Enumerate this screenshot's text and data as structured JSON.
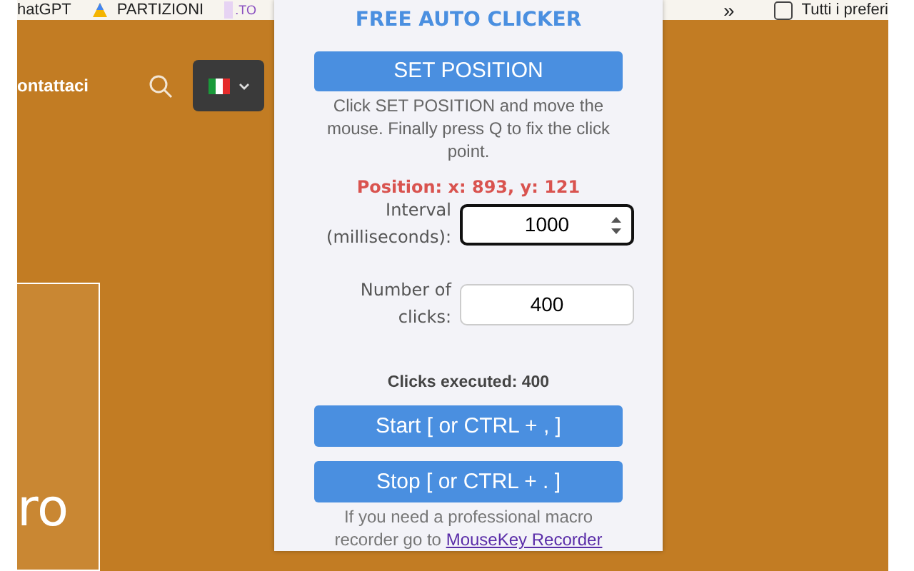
{
  "bookmarks_bar": {
    "items": [
      {
        "kind": "plain",
        "label": "hatGPT"
      },
      {
        "kind": "triangle",
        "label": "PARTIZIONI"
      },
      {
        "kind": "tile",
        "label": ".TO"
      }
    ],
    "overflow": "»",
    "folder": {
      "label": "Tutti i preferi"
    }
  },
  "website": {
    "nav_link": "ontattaci",
    "hero_text": "ro"
  },
  "popup": {
    "title": "FREE AUTO CLICKER",
    "set_button": "SET POSITION",
    "help": "Click SET POSITION and move the mouse. Finally press Q to fix the click point.",
    "position": "Position: x: 893, y: 121",
    "fields": [
      {
        "label": "Interval (milliseconds):",
        "value": "1000",
        "focused": true,
        "spinner": true
      },
      {
        "label": "Number of clicks:",
        "value": "400",
        "focused": false,
        "spinner": false
      }
    ],
    "clicks_executed": "Clicks executed: 400",
    "buttons": [
      "Start [ or CTRL + , ]",
      "Stop [ or CTRL + . ]"
    ],
    "footer": {
      "text": "If you need a professional macro recorder go to",
      "link": "MouseKey Recorder"
    }
  }
}
